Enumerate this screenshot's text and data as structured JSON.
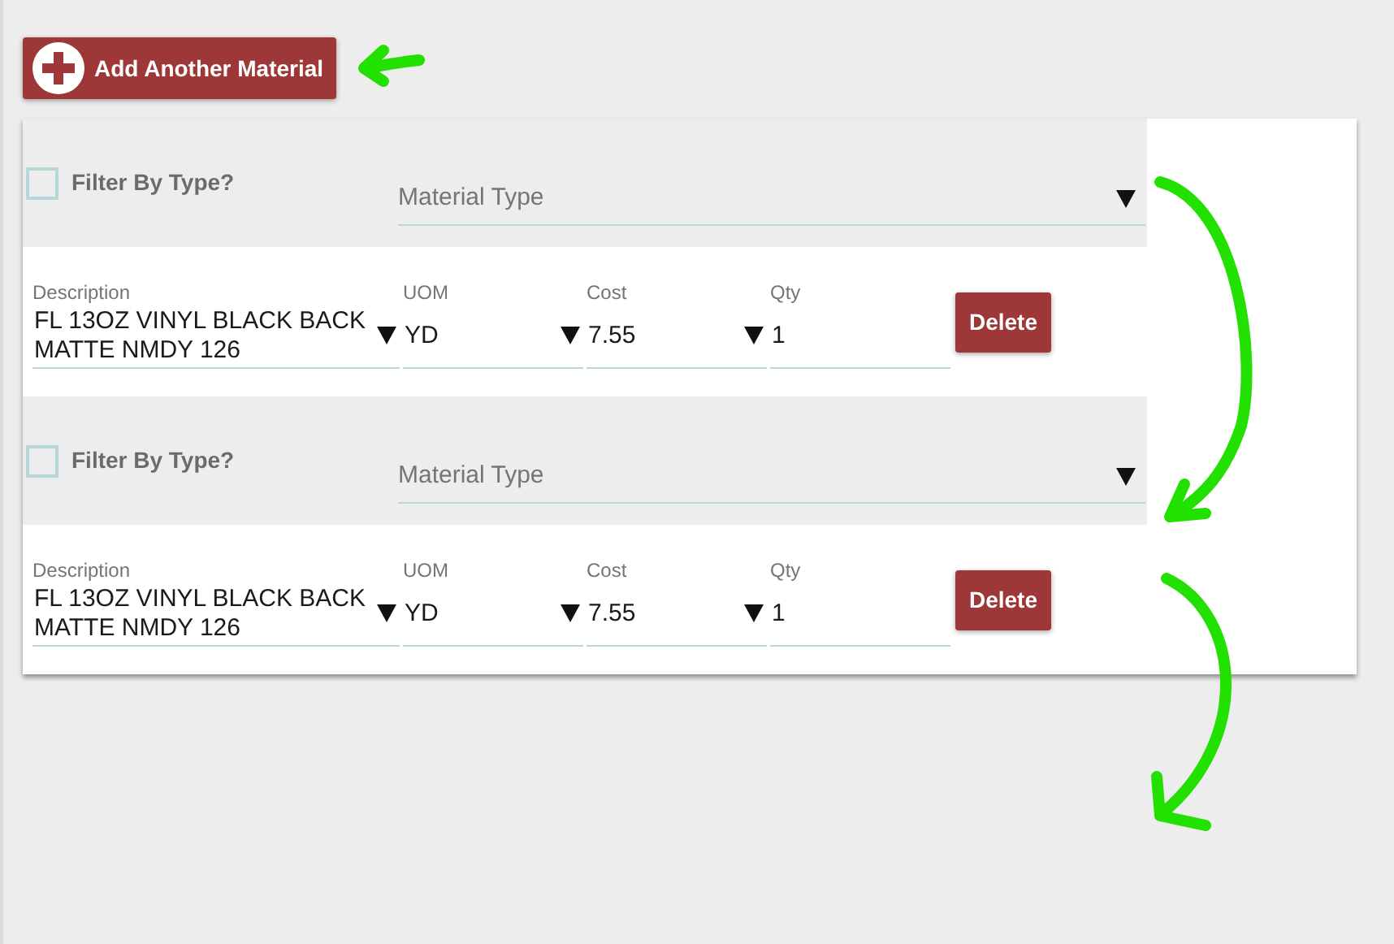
{
  "add_button": {
    "label": "Add Another Material"
  },
  "materials": [
    {
      "filter": {
        "label": "Filter By Type?",
        "checked": false
      },
      "material_type": {
        "placeholder": "Material Type"
      },
      "fields": [
        {
          "kind": "select",
          "label": "Description",
          "value": "FL 13OZ VINYL BLACK BACK MATTE NMDY 126"
        },
        {
          "kind": "select",
          "label": "UOM",
          "value": "YD"
        },
        {
          "kind": "select",
          "label": "Cost",
          "value": "7.55"
        },
        {
          "kind": "text",
          "label": "Qty",
          "value": "1"
        }
      ],
      "delete_label": "Delete"
    },
    {
      "filter": {
        "label": "Filter By Type?",
        "checked": false
      },
      "material_type": {
        "placeholder": "Material Type"
      },
      "fields": [
        {
          "kind": "select",
          "label": "Description",
          "value": "FL 13OZ VINYL BLACK BACK MATTE NMDY 126"
        },
        {
          "kind": "select",
          "label": "UOM",
          "value": "YD"
        },
        {
          "kind": "select",
          "label": "Cost",
          "value": "7.55"
        },
        {
          "kind": "text",
          "label": "Qty",
          "value": "1"
        }
      ],
      "delete_label": "Delete"
    }
  ]
}
